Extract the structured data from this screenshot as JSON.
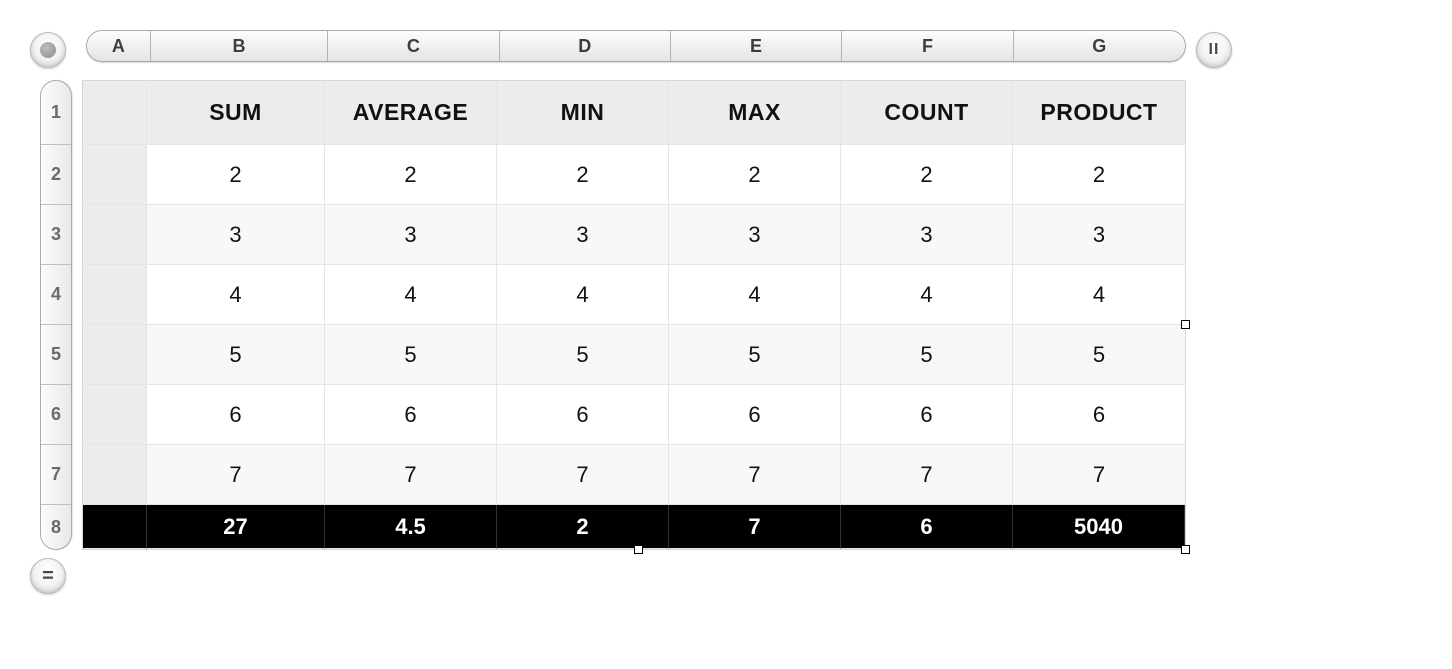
{
  "columns": [
    "A",
    "B",
    "C",
    "D",
    "E",
    "F",
    "G"
  ],
  "row_numbers": [
    "1",
    "2",
    "3",
    "4",
    "5",
    "6",
    "7",
    "8"
  ],
  "header_row": [
    "",
    "SUM",
    "AVERAGE",
    "MIN",
    "MAX",
    "COUNT",
    "PRODUCT"
  ],
  "data_rows": [
    [
      "",
      "2",
      "2",
      "2",
      "2",
      "2",
      "2"
    ],
    [
      "",
      "3",
      "3",
      "3",
      "3",
      "3",
      "3"
    ],
    [
      "",
      "4",
      "4",
      "4",
      "4",
      "4",
      "4"
    ],
    [
      "",
      "5",
      "5",
      "5",
      "5",
      "5",
      "5"
    ],
    [
      "",
      "6",
      "6",
      "6",
      "6",
      "6",
      "6"
    ],
    [
      "",
      "7",
      "7",
      "7",
      "7",
      "7",
      "7"
    ]
  ],
  "result_row": [
    "",
    "27",
    "4.5",
    "2",
    "7",
    "6",
    "5040"
  ],
  "icons": {
    "pause": "II",
    "equals": "="
  }
}
